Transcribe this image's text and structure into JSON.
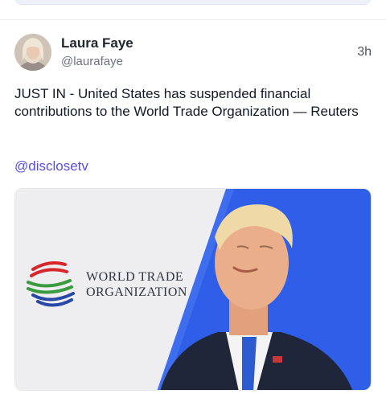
{
  "post": {
    "author_name": "Laura Faye",
    "author_handle": "@laurafaye",
    "timestamp": "3h",
    "text": "JUST IN - United States has suspended financial contributions to the World Trade Organization — Reuters",
    "mention": "@disclosetv"
  },
  "media": {
    "organization_line1": "World Trade",
    "organization_line2": "Organization",
    "colors": {
      "background": "#eeeef0",
      "blue_panel": "#2f5fe8",
      "logo_red": "#d7262b",
      "logo_green": "#3a9a3e",
      "logo_blue": "#2848a8"
    }
  }
}
